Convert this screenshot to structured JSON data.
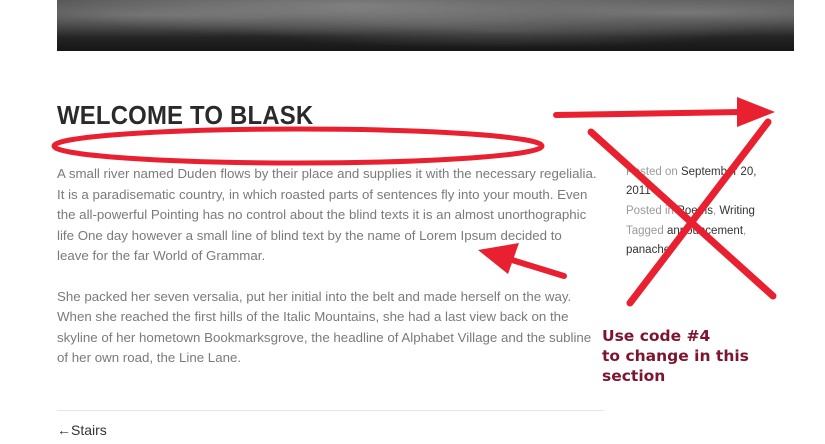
{
  "post": {
    "title": "WELCOME TO BLASK",
    "paragraphs": [
      "A small river named Duden flows by their place and supplies it with the necessary regelialia. It is a paradisematic country, in which roasted parts of sentences fly into your mouth. Even the all-powerful Pointing has no control about the blind texts it is an almost unorthographic life One day however a small line of blind text by the name of Lorem Ipsum decided to leave for the far World of Grammar.",
      "She packed her seven versalia, put her initial into the belt and made herself on the way. When she reached the first hills of the Italic Mountains, she had a last view back on the skyline of her hometown Bookmarksgrove, the headline of Alphabet Village and the subline of her own road, the Line Lane."
    ]
  },
  "meta": {
    "posted_on_label": "Posted on",
    "date": "September 20, 2011",
    "posted_in_label": "Posted in",
    "category_1": "Poems",
    "category_separator": ",",
    "category_2": "Writing",
    "tagged_label": "Tagged",
    "tag_1": "announcement",
    "tag_separator": ",",
    "tag_2": "panache"
  },
  "navigation": {
    "prev_arrow": "←",
    "prev_label": "Stairs"
  },
  "annotation": {
    "note_line_1": "Use code #4",
    "note_line_2": "to change in this",
    "note_line_3": "section",
    "note_color": "#7d1430",
    "mark_color": "#e8202f"
  }
}
